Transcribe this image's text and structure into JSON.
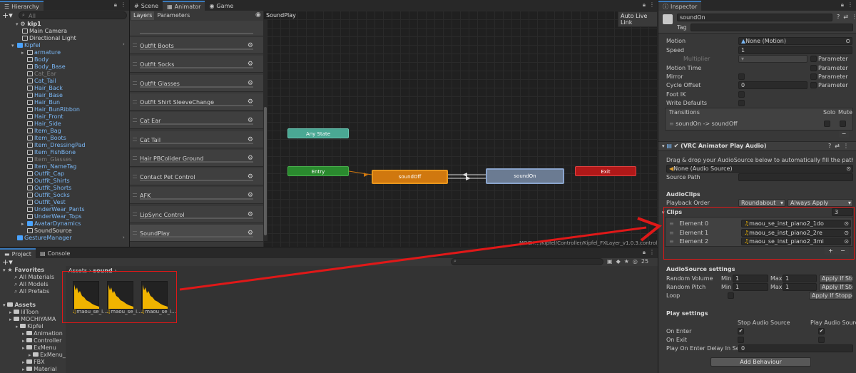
{
  "hierarchy": {
    "tab": "Hierarchy",
    "search_placeholder": "All",
    "scene": "kip1",
    "rows": [
      {
        "label": "Main Camera",
        "indent": 3,
        "style": "white",
        "icon": "cube-icon",
        "arrow": false
      },
      {
        "label": "Directional Light",
        "indent": 3,
        "style": "white",
        "icon": "cube-icon",
        "arrow": false
      },
      {
        "label": "Kipfel",
        "indent": 2,
        "style": "blue",
        "icon": "prefab-icon",
        "arrow": true,
        "open": true
      },
      {
        "label": "armature",
        "indent": 4,
        "style": "blue",
        "icon": "cube-icon",
        "arrow": true
      },
      {
        "label": "Body",
        "indent": 4,
        "style": "blue",
        "icon": "cube-icon",
        "arrow": false
      },
      {
        "label": "Body_Base",
        "indent": 4,
        "style": "blue",
        "icon": "cube-icon",
        "arrow": false
      },
      {
        "label": "Cat_Ear",
        "indent": 4,
        "style": "gray",
        "icon": "cube-icon",
        "arrow": false
      },
      {
        "label": "Cat_Tail",
        "indent": 4,
        "style": "blue",
        "icon": "cube-icon",
        "arrow": false
      },
      {
        "label": "Hair_Back",
        "indent": 4,
        "style": "blue",
        "icon": "cube-icon",
        "arrow": false
      },
      {
        "label": "Hair_Base",
        "indent": 4,
        "style": "blue",
        "icon": "cube-icon",
        "arrow": false
      },
      {
        "label": "Hair_Bun",
        "indent": 4,
        "style": "blue",
        "icon": "cube-icon",
        "arrow": false
      },
      {
        "label": "Hair_BunRibbon",
        "indent": 4,
        "style": "blue",
        "icon": "cube-icon",
        "arrow": false
      },
      {
        "label": "Hair_Front",
        "indent": 4,
        "style": "blue",
        "icon": "cube-icon",
        "arrow": false
      },
      {
        "label": "Hair_Side",
        "indent": 4,
        "style": "blue",
        "icon": "cube-icon",
        "arrow": false
      },
      {
        "label": "Item_Bag",
        "indent": 4,
        "style": "blue",
        "icon": "cube-icon",
        "arrow": false
      },
      {
        "label": "Item_Boots",
        "indent": 4,
        "style": "blue",
        "icon": "cube-icon",
        "arrow": false
      },
      {
        "label": "Item_DressingPad",
        "indent": 4,
        "style": "blue",
        "icon": "cube-icon",
        "arrow": false
      },
      {
        "label": "Item_FishBone",
        "indent": 4,
        "style": "blue",
        "icon": "cube-icon",
        "arrow": false
      },
      {
        "label": "Item_Glasses",
        "indent": 4,
        "style": "gray",
        "icon": "cube-icon",
        "arrow": false
      },
      {
        "label": "Item_NameTag",
        "indent": 4,
        "style": "blue",
        "icon": "cube-icon",
        "arrow": false
      },
      {
        "label": "Outfit_Cap",
        "indent": 4,
        "style": "blue",
        "icon": "cube-icon",
        "arrow": false
      },
      {
        "label": "Outfit_Shirts",
        "indent": 4,
        "style": "blue",
        "icon": "cube-icon",
        "arrow": false
      },
      {
        "label": "Outfit_Shorts",
        "indent": 4,
        "style": "blue",
        "icon": "cube-icon",
        "arrow": false
      },
      {
        "label": "Outfit_Socks",
        "indent": 4,
        "style": "blue",
        "icon": "cube-icon",
        "arrow": false
      },
      {
        "label": "Outfit_Vest",
        "indent": 4,
        "style": "blue",
        "icon": "cube-icon",
        "arrow": false
      },
      {
        "label": "UnderWear_Pants",
        "indent": 4,
        "style": "blue",
        "icon": "cube-icon",
        "arrow": false
      },
      {
        "label": "UnderWear_Tops",
        "indent": 4,
        "style": "blue",
        "icon": "cube-icon",
        "arrow": false
      },
      {
        "label": "AvatarDynamics",
        "indent": 4,
        "style": "blue",
        "icon": "prefab-icon",
        "arrow": true
      },
      {
        "label": "SoundSource",
        "indent": 4,
        "style": "white",
        "icon": "cube-icon",
        "arrow": false
      },
      {
        "label": "GestureManager",
        "indent": 2,
        "style": "blue",
        "icon": "prefab-icon",
        "arrow": false
      }
    ]
  },
  "animator": {
    "tabs": [
      "Scene",
      "Animator",
      "Game"
    ],
    "subtabs": [
      "Layers",
      "Parameters"
    ],
    "breadcrumb": "SoundPlay",
    "auto_live_link": "Auto Live Link",
    "layers": [
      "Outfit Boots",
      "Outfit Socks",
      "Outfit Glasses",
      "Outfit Shirt  SleeveChange",
      "Cat Ear",
      "Cat Tail",
      "Hair PBColider Ground",
      "Contact Pet Control",
      "AFK",
      "LipSync Control",
      "SoundPlay"
    ],
    "nodes": {
      "any_state": "Any State",
      "entry": "Entry",
      "sound_off": "soundOff",
      "sound_on": "soundOn",
      "exit": "Exit"
    },
    "path": "MOCH…/Kipfel/Controller/Kipfel_FXLayer_v1.0.3.controller"
  },
  "project": {
    "tabs": [
      "Project",
      "Console"
    ],
    "favorites": "Favorites",
    "favorites_items": [
      "All Materials",
      "All Models",
      "All Prefabs"
    ],
    "assets": "Assets",
    "asset_rows": [
      {
        "label": "lilToon",
        "indent": 1
      },
      {
        "label": "MOCHIYAMA",
        "indent": 1
      },
      {
        "label": "Kipfel",
        "indent": 2
      },
      {
        "label": "Animation",
        "indent": 3
      },
      {
        "label": "Controller",
        "indent": 3
      },
      {
        "label": "ExMenu",
        "indent": 3
      },
      {
        "label": "ExMenu_ic",
        "indent": 4
      },
      {
        "label": "FBX",
        "indent": 3
      },
      {
        "label": "Material",
        "indent": 3
      }
    ],
    "breadcrumb_root": "Assets",
    "breadcrumb_folder": "sound",
    "count": "25",
    "clips": [
      "maou_se_i…",
      "maou_se_i…",
      "maou_se_i…"
    ]
  },
  "inspector": {
    "tab": "Inspector",
    "name": "soundOn",
    "tag_label": "Tag",
    "motion_label": "Motion",
    "motion_value": "None (Motion)",
    "speed_label": "Speed",
    "speed_value": "1",
    "multiplier_label": "Multiplier",
    "parameter_label": "Parameter",
    "motion_time_label": "Motion Time",
    "mirror_label": "Mirror",
    "cycle_offset_label": "Cycle Offset",
    "cycle_offset_value": "0",
    "foot_ik_label": "Foot IK",
    "write_defaults_label": "Write Defaults",
    "transitions_label": "Transitions",
    "solo_label": "Solo",
    "mute_label": "Mute",
    "transition": "soundOn -> soundOff",
    "component_title": "(VRC Animator Play Audio)",
    "drag_hint": "Drag & drop your AudioSource below to automatically fill the path relative to",
    "audio_source_value": "None (Audio Source)",
    "source_path_label": "Source Path",
    "audio_clips_label": "AudioClips",
    "playback_order_label": "Playback Order",
    "playback_order_value": "Roundabout",
    "playback_apply_value": "Always Apply",
    "clips_label": "Clips",
    "clips_count": "3",
    "elements": [
      {
        "label": "Element 0",
        "value": "maou_se_inst_piano2_1do"
      },
      {
        "label": "Element 1",
        "value": "maou_se_inst_piano2_2re"
      },
      {
        "label": "Element 2",
        "value": "maou_se_inst_piano2_3mi"
      }
    ],
    "audio_settings_label": "AudioSource settings",
    "random_volume_label": "Random Volume",
    "random_pitch_label": "Random Pitch",
    "loop_label": "Loop",
    "min_label": "Min",
    "max_label": "Max",
    "min_value": "1",
    "max_value": "1",
    "apply_if_stop": "Apply If Sto…",
    "apply_if_stopped": "Apply If Stoppe…",
    "play_settings_label": "Play settings",
    "stop_audio_label": "Stop Audio Source",
    "play_audio_label": "Play Audio Source",
    "on_enter_label": "On Enter",
    "on_exit_label": "On Exit",
    "delay_label": "Play On Enter Delay In Secor",
    "delay_value": "0",
    "add_behaviour": "Add Behaviour"
  },
  "colors": {
    "annotation": "#e01818",
    "selection_blue": "#3a79bb"
  }
}
